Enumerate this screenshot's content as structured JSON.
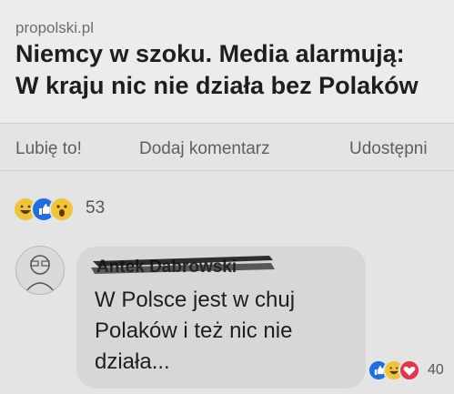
{
  "post": {
    "link_domain": "propolski.pl",
    "headline_line1": "Niemcy w szoku. Media alarmują:",
    "headline_line2": "W kraju nic nie działa bez Polaków"
  },
  "actions": {
    "like": "Lubię to!",
    "comment": "Dodaj komentarz",
    "share": "Udostępni"
  },
  "reactions": {
    "icons": [
      "haha-icon",
      "like-icon",
      "wow-icon"
    ],
    "count": "53"
  },
  "comment": {
    "author_name": "Antek Dabrowski",
    "line1": "W Polsce jest w chuj",
    "line2": "Polaków i też nic nie",
    "line3": "działa...",
    "reactions": {
      "icons": [
        "like-icon",
        "haha-icon",
        "love-icon"
      ],
      "count": "40"
    }
  },
  "colors": {
    "background": "#e4e4e4",
    "bubble": "#d7d7d7",
    "like": "#1f6fe0",
    "haha": "#f0c43a",
    "love": "#e2364c"
  }
}
